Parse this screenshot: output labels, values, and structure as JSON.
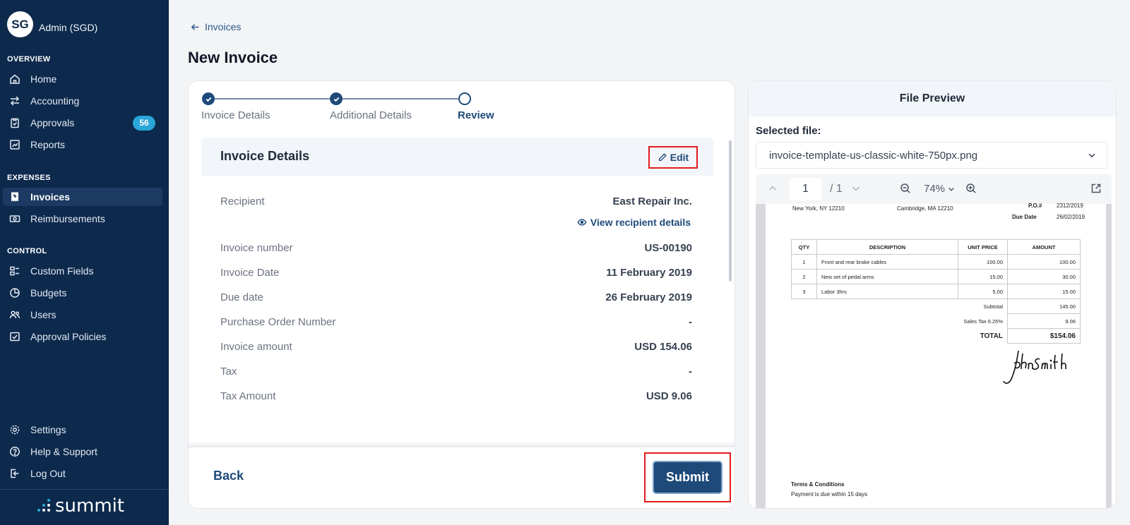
{
  "account": {
    "initials": "SG",
    "name": "Admin (SGD)"
  },
  "sidebar": {
    "sections": {
      "overview": "OVERVIEW",
      "expenses": "EXPENSES",
      "control": "CONTROL"
    },
    "items": {
      "home": "Home",
      "accounting": "Accounting",
      "approvals": "Approvals",
      "approvals_badge": "56",
      "reports": "Reports",
      "invoices": "Invoices",
      "reimbursements": "Reimbursements",
      "custom_fields": "Custom Fields",
      "budgets": "Budgets",
      "users": "Users",
      "approval_policies": "Approval Policies",
      "settings": "Settings",
      "help": "Help & Support",
      "logout": "Log Out"
    },
    "brand": "summit"
  },
  "breadcrumb": {
    "back_label": "Invoices"
  },
  "page": {
    "title": "New Invoice"
  },
  "stepper": {
    "steps": [
      "Invoice Details",
      "Additional Details",
      "Review"
    ],
    "current_index": 2
  },
  "details": {
    "title": "Invoice Details",
    "edit_label": "Edit",
    "view_recipient_label": "View recipient details",
    "rows": [
      {
        "label": "Recipient",
        "value": "East Repair Inc."
      },
      {
        "label": "Invoice number",
        "value": "US-00190"
      },
      {
        "label": "Invoice Date",
        "value": "11 February 2019"
      },
      {
        "label": "Due date",
        "value": "26 February 2019"
      },
      {
        "label": "Purchase Order Number",
        "value": "-"
      },
      {
        "label": "Invoice amount",
        "value": "USD 154.06"
      },
      {
        "label": "Tax",
        "value": "-"
      },
      {
        "label": "Tax Amount",
        "value": "USD 9.06"
      }
    ]
  },
  "footer": {
    "back_label": "Back",
    "submit_label": "Submit"
  },
  "preview": {
    "title": "File Preview",
    "selected_label": "Selected file:",
    "file_name": "invoice-template-us-classic-white-750px.png",
    "page_current": "1",
    "page_total": "/ 1",
    "zoom": "74%",
    "document": {
      "addr_left": "New York, NY 12210",
      "addr_mid": "Cambridge, MA 12210",
      "po_label": "P.O.#",
      "po_value": "2312/2019",
      "due_label": "Due Date",
      "due_value": "26/02/2019",
      "headers": [
        "QTY",
        "DESCRIPTION",
        "UNIT PRICE",
        "AMOUNT"
      ],
      "lines": [
        {
          "qty": "1",
          "desc": "Front and rear brake cables",
          "unit": "100.00",
          "amount": "100.00"
        },
        {
          "qty": "2",
          "desc": "New set of pedal arms",
          "unit": "15.00",
          "amount": "30.00"
        },
        {
          "qty": "3",
          "desc": "Labor 3hrs",
          "unit": "5.00",
          "amount": "15.00"
        }
      ],
      "subtotal_label": "Subtotal",
      "subtotal_value": "145.00",
      "tax_label": "Sales Tax 6.25%",
      "tax_value": "9.06",
      "total_label": "TOTAL",
      "total_value": "$154.06",
      "signature": "John Smith",
      "terms_title": "Terms & Conditions",
      "terms_text": "Payment is due within 15 days"
    }
  },
  "colors": {
    "sidebar_bg": "#0d2a4d",
    "primary": "#1e4a7a",
    "badge": "#2aa6d9",
    "highlight_outline": "#e11d1d"
  }
}
